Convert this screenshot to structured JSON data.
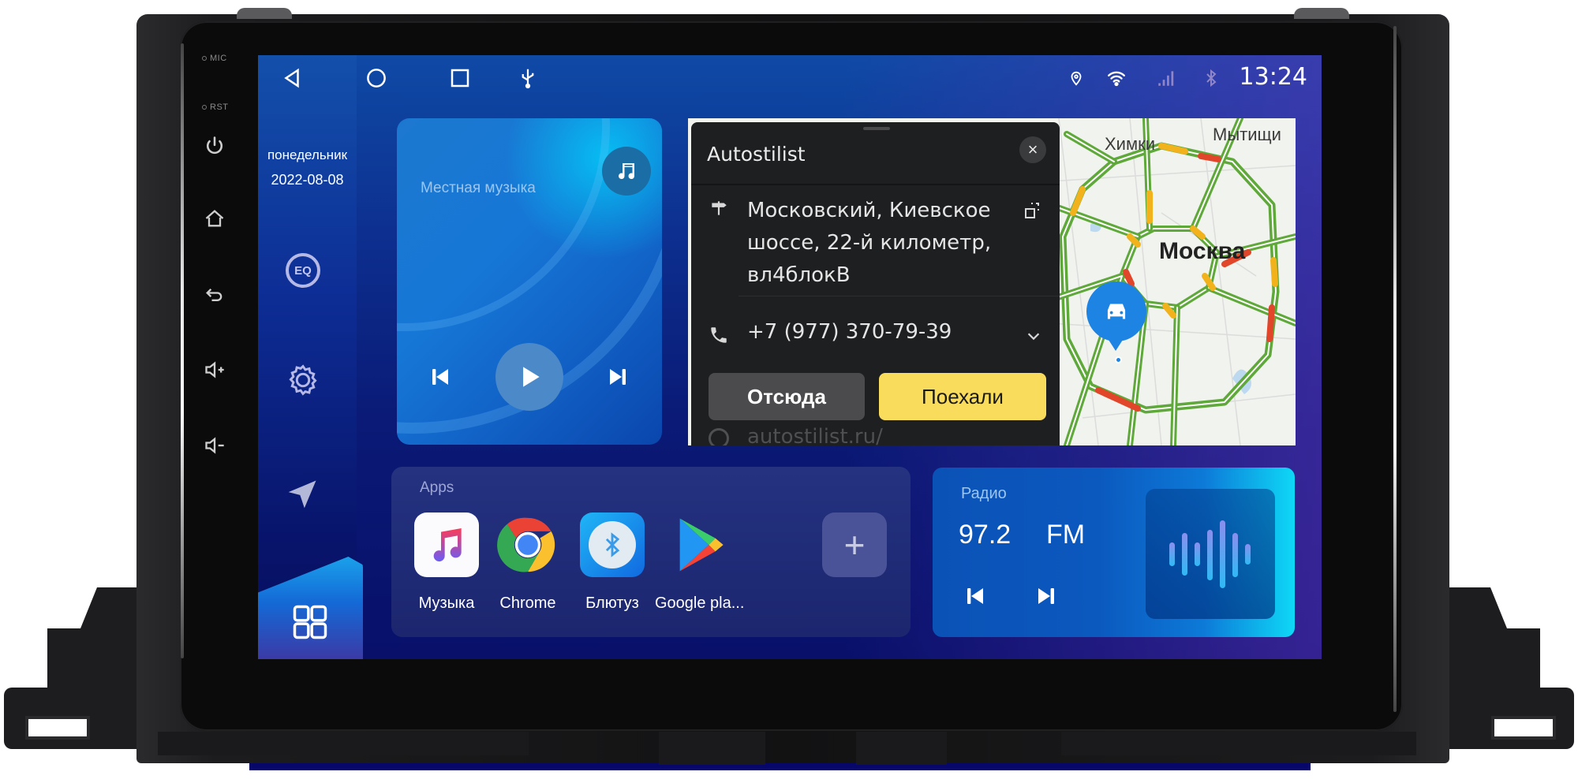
{
  "device": {
    "hw_labels": {
      "mic": "MIC",
      "rst": "RST"
    },
    "hw_buttons": [
      "power-icon",
      "home-icon",
      "back-icon",
      "volume-up-icon",
      "volume-down-icon"
    ]
  },
  "status_bar": {
    "nav": [
      "back-icon",
      "home-icon",
      "recents-icon",
      "usb-icon"
    ],
    "indicators": [
      "location-icon",
      "wifi-icon",
      "signal-icon",
      "bluetooth-icon"
    ],
    "time": "13:24"
  },
  "sidebar": {
    "weekday": "понедельник",
    "date": "2022-08-08",
    "eq_label": "EQ",
    "items": [
      "eq-icon",
      "settings-icon",
      "navigation-icon",
      "apps-grid-icon"
    ]
  },
  "music": {
    "title": "Местная музыка",
    "controls": [
      "previous-icon",
      "play-icon",
      "next-icon"
    ]
  },
  "map": {
    "labels": {
      "khimki": "Химки",
      "mytishchi": "Мытищи",
      "moscow": "Москва"
    },
    "colors": {
      "free": "#5fa83a",
      "slow": "#f2b21c",
      "jam": "#e2462a",
      "pin": "#1d84e4"
    },
    "popup": {
      "title": "Autostilist",
      "close": "×",
      "address": "Московский, Киевское шоссе, 22-й километр, вл4блокВ",
      "phone": "+7 (977) 370-79-39",
      "btn_from": "Отсюда",
      "btn_go": "Поехали",
      "website": "autostilist.ru/"
    }
  },
  "apps": {
    "label": "Apps",
    "items": [
      {
        "name": "Музыка",
        "icon": "music-app-icon"
      },
      {
        "name": "Chrome",
        "icon": "chrome-icon"
      },
      {
        "name": "Блютуз",
        "icon": "bluetooth-app-icon"
      },
      {
        "name": "Google pla...",
        "icon": "google-play-icon"
      },
      {
        "name": "",
        "icon": "add-icon"
      }
    ],
    "add_symbol": "+"
  },
  "radio": {
    "label": "Радио",
    "frequency": "97.2",
    "band": "FM",
    "controls": [
      "previous-icon",
      "next-icon"
    ]
  }
}
